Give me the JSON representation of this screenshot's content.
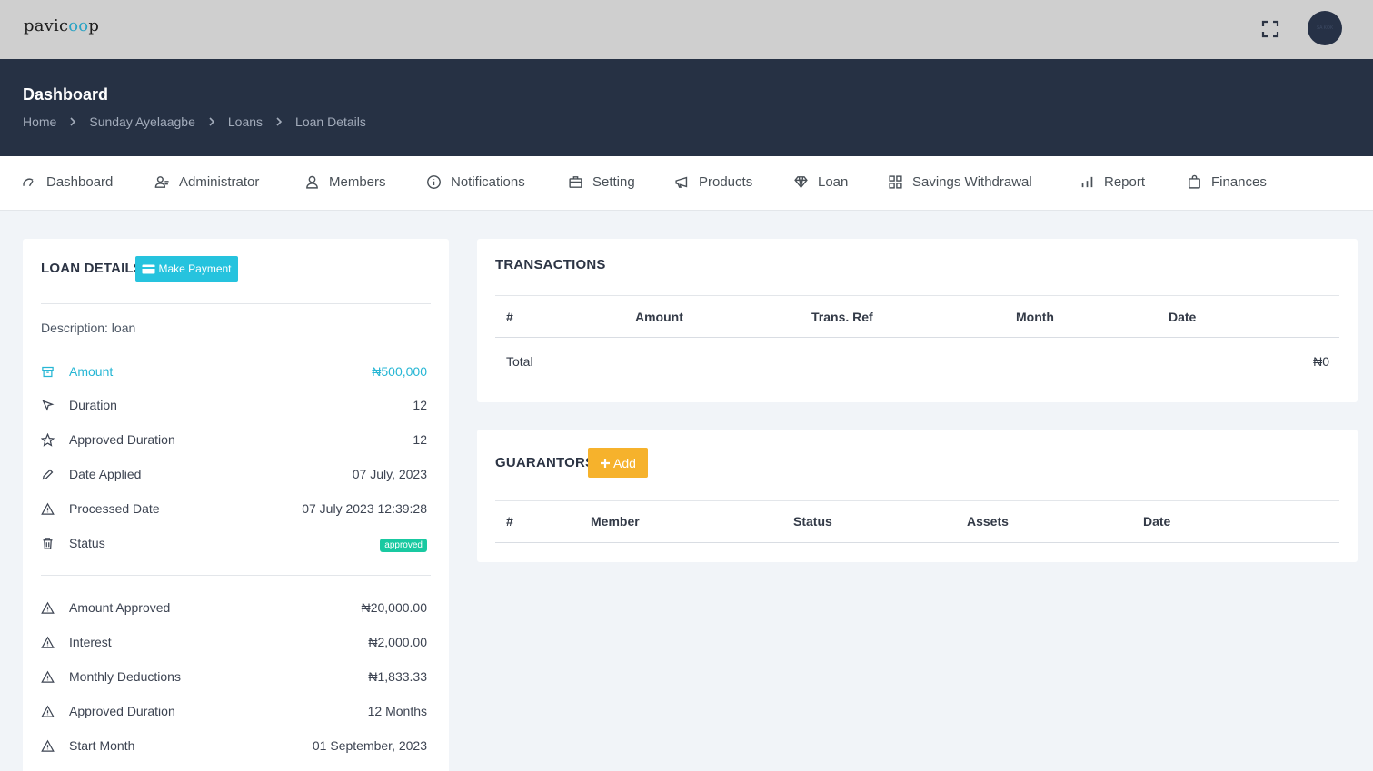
{
  "topbar": {
    "logo_prefix": "pavic",
    "logo_oo": "oo",
    "logo_suffix": "p",
    "avatar_text": "SA KOK"
  },
  "header": {
    "title": "Dashboard",
    "breadcrumb": [
      "Home",
      "Sunday Ayelaagbe",
      "Loans",
      "Loan Details"
    ]
  },
  "nav": {
    "items": [
      {
        "label": "Dashboard",
        "icon": "speedometer-icon"
      },
      {
        "label": "Administrator",
        "icon": "users-icon"
      },
      {
        "label": "Members",
        "icon": "user-icon"
      },
      {
        "label": "Notifications",
        "icon": "info-icon"
      },
      {
        "label": "Setting",
        "icon": "briefcase-icon"
      },
      {
        "label": "Products",
        "icon": "megaphone-icon"
      },
      {
        "label": "Loan",
        "icon": "diamond-icon"
      },
      {
        "label": "Savings Withdrawal",
        "icon": "grid-icon"
      },
      {
        "label": "Report",
        "icon": "bar-chart-icon"
      },
      {
        "label": "Finances",
        "icon": "shopping-bag-icon"
      }
    ]
  },
  "loan": {
    "title": "LOAN DETAILS",
    "pay_label": "Make Payment",
    "description": "Description: loan",
    "rows": [
      {
        "label": "Amount",
        "value": "₦500,000"
      },
      {
        "label": "Duration",
        "value": "12"
      },
      {
        "label": "Approved Duration",
        "value": "12"
      },
      {
        "label": "Date Applied",
        "value": "07 July, 2023"
      },
      {
        "label": "Processed Date",
        "value": "07 July 2023 12:39:28"
      },
      {
        "label": "Status",
        "value": "approved"
      }
    ],
    "rows2": [
      {
        "label": "Amount Approved",
        "value": "₦20,000.00"
      },
      {
        "label": "Interest",
        "value": "₦2,000.00"
      },
      {
        "label": "Monthly Deductions",
        "value": "₦1,833.33"
      },
      {
        "label": "Approved Duration",
        "value": "12 Months"
      },
      {
        "label": "Start Month",
        "value": "01 September, 2023"
      }
    ]
  },
  "transactions": {
    "title": "TRANSACTIONS",
    "columns": [
      "#",
      "Amount",
      "Trans. Ref",
      "Month",
      "Date"
    ],
    "total_label": "Total",
    "total_value": "₦0"
  },
  "guarantors": {
    "title": "GUARANTORS",
    "add_label": "Add",
    "columns": [
      "#",
      "Member",
      "Status",
      "Assets",
      "Date"
    ]
  },
  "colors": {
    "header_bg": "#263144",
    "topbar_bg": "#cfcfcf",
    "accent_cyan": "#26c3de",
    "accent_orange": "#f6b22c",
    "badge_green": "#19c9a1"
  }
}
